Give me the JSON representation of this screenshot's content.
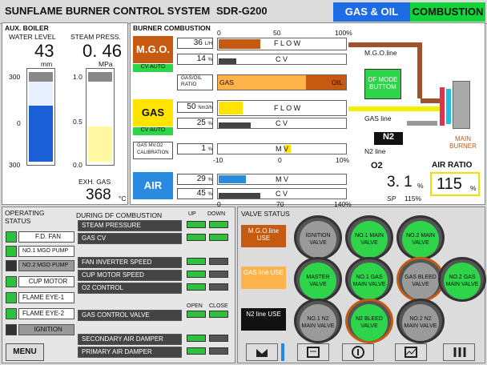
{
  "header": {
    "title": "SUNFLAME BURNER CONTROL SYSTEM",
    "model": "SDR-G200",
    "tab_gas_oil": "GAS & OIL",
    "tab_combustion": "COMBUSTION"
  },
  "boiler": {
    "title": "AUX. BOILER",
    "water_level_label": "WATER LEVEL",
    "water_level": "43",
    "water_unit": "mm",
    "steam_label": "STEAM PRESS.",
    "steam": "0. 46",
    "steam_unit": "MPa",
    "wl_ticks": [
      "300",
      "0",
      "300"
    ],
    "sp_ticks": [
      "1.0",
      "0.5",
      "0.0"
    ],
    "exh_label": "EXH. GAS",
    "exh_value": "368",
    "exh_unit": "°C",
    "water_level_fill": 0.62,
    "steam_fill": 0.46
  },
  "burner": {
    "title": "BURNER COMBUSTION",
    "scale": [
      "0",
      "50",
      "100%"
    ],
    "mgo": {
      "label": "M.G.O.",
      "auto": "CV AUTO",
      "flow": "36",
      "flow_unit": "L/H",
      "flow_text": "F L O W",
      "cv": "14",
      "cv_unit": "%",
      "cv_text": "C V",
      "flow_fill": 0.33,
      "cv_fill": 0.14
    },
    "ratio": {
      "label": "GAS/OIL RATIO",
      "gas": "GAS",
      "oil": "OIL",
      "gas_fill": 0.68
    },
    "gas": {
      "label": "GAS",
      "auto": "CV AUTO",
      "flow": "50",
      "flow_unit": "Nm3/h",
      "flow_text": "F L O W",
      "cv": "25",
      "cv_unit": "%",
      "cv_text": "C V",
      "flow_fill": 0.19,
      "cv_fill": 0.25
    },
    "gas_cal": {
      "label": "GAS MV.O2 CALIBRATION",
      "value": "1",
      "unit": "%",
      "mv_text": "M V",
      "scale": [
        "-10",
        "0",
        "10%"
      ]
    },
    "air": {
      "label": "AIR",
      "mv": "29",
      "mv_unit": "%",
      "mv_text": "M V",
      "cv": "45",
      "cv_unit": "%",
      "cv_text": "C V",
      "scale": [
        "0",
        "70",
        "140%"
      ],
      "mv_fill": 0.21,
      "cv_fill": 0.32
    },
    "mgo_line": "M.G.O.line",
    "gas_line": "GAS line",
    "n2": "N2",
    "n2_line": "N2 line",
    "df_mode": "DF MODE BUTTOM",
    "main_burner": "MAIN BURNER",
    "o2_label": "O2",
    "o2_value": "3. 1",
    "o2_unit": "%",
    "sp_label": "SP",
    "sp_value": "115%",
    "air_ratio_label": "AIR RATIO",
    "air_ratio": "115",
    "air_ratio_unit": "%"
  },
  "status": {
    "title": "OPERATING STATUS",
    "items": [
      "F.D. FAN",
      "NO.1 MGO PUMP",
      "NO.2 MGO PUMP",
      "CUP  MOTOR",
      "FLAME EYE-1",
      "FLAME EYE-2",
      "IGNITION"
    ],
    "df_title": "DURING DF COMBUSTION",
    "up": "UP",
    "down": "DOWN",
    "open": "OPEN",
    "close": "CLOSE",
    "df_items": [
      "STEAM PRESSURE",
      "GAS CV",
      "FAN INVERTER SPEED",
      "CUP MOTOR SPEED",
      "O2 CONTROL",
      "GAS CONTROL VALVE",
      "SECONDARY AIR DAMPER",
      "PRIMARY AIR DAMPER"
    ],
    "menu": "MENU"
  },
  "valve": {
    "title": "VALVE STATUS",
    "mgo_use": "M.G.O.line USE",
    "gas_use": "GAS line USE",
    "n2_use": "N2 line USE",
    "v": [
      "IGNITION VALVE",
      "NO.1 MAIN VALVE",
      "NO.2 MAIN VALVE",
      "MASTER VALVE",
      "NO.1 GAS MAIN VALVE",
      "GAS BLEED VALVE",
      "NO.2 GAS MAIN VALVE",
      "NO.1 N2 MAIN VALVE",
      "N2 BLEED VALVE",
      "NO.2 N2 MAIN VALVE"
    ]
  }
}
